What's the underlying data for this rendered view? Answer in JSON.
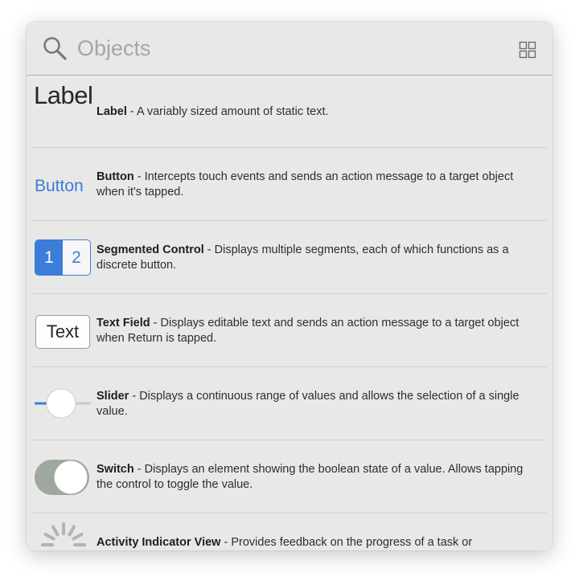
{
  "search": {
    "placeholder": "Objects",
    "value": ""
  },
  "thumbs": {
    "label_text": "Label",
    "button_text": "Button",
    "segment_1": "1",
    "segment_2": "2",
    "textfield_text": "Text"
  },
  "items": [
    {
      "title": "Label",
      "separator": " - ",
      "description": "A variably sized amount of static text."
    },
    {
      "title": "Button",
      "separator": " - ",
      "description": "Intercepts touch events and sends an action message to a target object when it's tapped."
    },
    {
      "title": "Segmented Control",
      "separator": " - ",
      "description": "Displays multiple segments, each of which functions as a discrete button."
    },
    {
      "title": "Text Field",
      "separator": " - ",
      "description": "Displays editable text and sends an action message to a target object when Return is tapped."
    },
    {
      "title": "Slider",
      "separator": " - ",
      "description": "Displays a continuous range of values and allows the selection of a single value."
    },
    {
      "title": "Switch",
      "separator": " - ",
      "description": "Displays an element showing the boolean state of a value. Allows tapping the control to toggle the value."
    },
    {
      "title": "Activity Indicator View",
      "separator": " - ",
      "description": "Provides feedback on the progress of a task or"
    }
  ],
  "icons": {
    "search": "search-icon",
    "grid": "grid-view-icon",
    "slider": "slider-thumbnail-icon",
    "switch": "switch-thumbnail-icon",
    "activity": "activity-indicator-icon"
  },
  "colors": {
    "panel_bg": "#e8e8e6",
    "accent_blue": "#3b7dd8",
    "switch_on": "#9fa89f",
    "placeholder": "#a6a6a6"
  }
}
